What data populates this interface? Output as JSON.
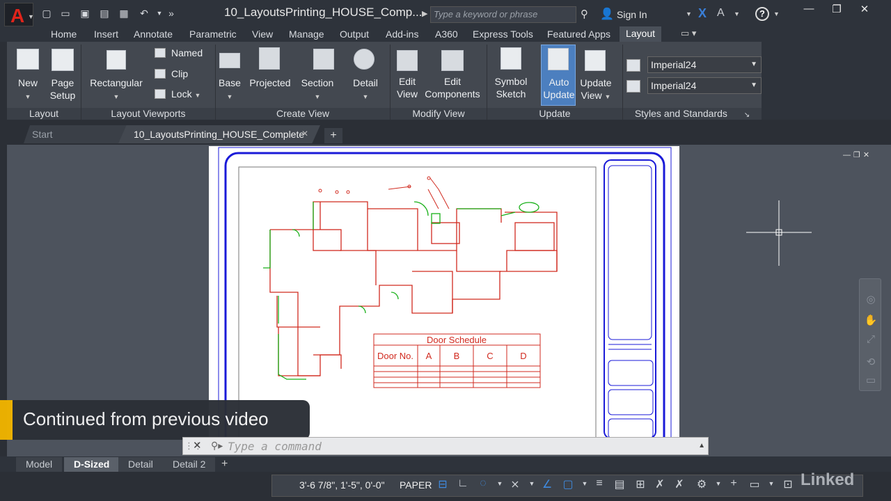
{
  "titlebar": {
    "document_title": "10_LayoutsPrinting_HOUSE_Comp...",
    "search_placeholder": "Type a keyword or phrase",
    "sign_in": "Sign In"
  },
  "ribbon_tabs": [
    "Home",
    "Insert",
    "Annotate",
    "Parametric",
    "View",
    "Manage",
    "Output",
    "Add-ins",
    "A360",
    "Express Tools",
    "Featured Apps",
    "Layout"
  ],
  "ribbon": {
    "panels": [
      {
        "label": "Layout"
      },
      {
        "label": "Layout Viewports"
      },
      {
        "label": "Create View"
      },
      {
        "label": "Modify View"
      },
      {
        "label": "Update"
      },
      {
        "label": "Styles and Standards"
      }
    ],
    "buttons": {
      "new_line1": "New",
      "page_line1": "Page",
      "page_line2": "Setup",
      "rectangular": "Rectangular",
      "named": "Named",
      "clip": "Clip",
      "lock": "Lock",
      "base": "Base",
      "projected": "Projected",
      "section": "Section",
      "detail": "Detail",
      "edit_view_1": "Edit",
      "edit_view_2": "View",
      "edit_comp_1": "Edit",
      "edit_comp_2": "Components",
      "symbol_1": "Symbol",
      "symbol_2": "Sketch",
      "auto_1": "Auto",
      "auto_2": "Update",
      "update_view_1": "Update",
      "update_view_2": "View"
    },
    "styles": {
      "combo1": "Imperial24",
      "combo2": "Imperial24"
    }
  },
  "doc_tabs": {
    "start": "Start",
    "active": "10_LayoutsPrinting_HOUSE_Complete"
  },
  "drawing": {
    "door_schedule_title": "Door Schedule",
    "door_schedule_headers": [
      "Door No.",
      "A",
      "B",
      "C",
      "D"
    ]
  },
  "overlay": {
    "text": "Continued from previous video"
  },
  "command": {
    "placeholder": "Type a command"
  },
  "layout_tabs": [
    "Model",
    "D-Sized",
    "Detail",
    "Detail 2"
  ],
  "status": {
    "coords": "3'-6 7/8\", 1'-5\", 0'-0\"",
    "space": "PAPER"
  },
  "watermark": "Linked"
}
